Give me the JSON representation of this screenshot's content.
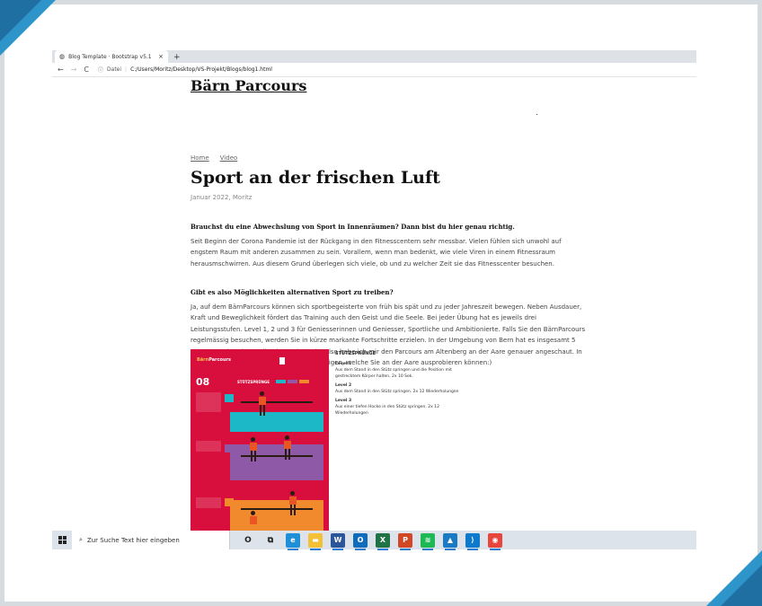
{
  "browser": {
    "tab_title": "Blog Template · Bootstrap v5.1",
    "tab_close": "×",
    "new_tab": "+",
    "back": "←",
    "forward": "→",
    "reload": "C",
    "info_icon": "ⓘ",
    "url_label": "Datei",
    "url_sep": "|",
    "url_path": "C:/Users/Moritz/Desktop/VS-Projekt/Blogs/blog1.html"
  },
  "site": {
    "brand": "Bärn Parcours",
    "nav": [
      "Home",
      "Video"
    ]
  },
  "post": {
    "title": "Sport an der frischen Luft",
    "meta": "Januar 2022, Moritz",
    "section1_heading": "Brauchst du eine Abwechslung von Sport in Innenräumen? Dann bist du hier genau richtig.",
    "section1_text": "Seit Beginn der Corona Pandemie ist der Rückgang in den Fitnesscentern sehr messbar. Vielen fühlen sich unwohl auf engstem Raum mit anderen zusammen zu sein. Vorallem, wenn man bedenkt, wie viele Viren in einem Fitnessraum herausmschwirren. Aus diesem Grund überlegen sich viele, ob und zu welcher Zeit sie das Fitnesscenter besuchen.",
    "section2_heading": "Gibt es also Möglichkeiten alternativen Sport zu treiben?",
    "section2_text": "Ja, auf dem BärnParcours können sich sportbegeisterte von früh bis spät und zu jeder Jahreszeit bewegen. Neben Ausdauer, Kraft und Beweglichkeit fördert das Training auch den Geist und die Seele. Bei jeder Übung hat es jeweils drei Leistungsstufen. Level 1, 2 und 3 für Geniesserinnen und Geniesser, Sportliche und Ambitionierte. Falls Sie den BärnParcours regelmässig besuchen, werden Sie in kürze markante Fortschritte erzielen. In der Umgebung von Bern hat es insgesamt 5 Parcours. Ich wohne selbst im Breitenrain, also habe ich mir den Parcours am Altenberg an der Aare genauer angeschaut. In der folge werde ich ein paar Übungen aufzeigen, welche Sie an der Aare ausprobieren können:)"
  },
  "poster": {
    "logo_a": "Bärn",
    "logo_b": "Parcours",
    "number": "08",
    "title": "STÜTZSPRÜNGE"
  },
  "exercise": {
    "title": "STÜTZSPRÜNGE",
    "level1": "Level 1",
    "level1_text": "Aus dem Stand in den Stütz springen und die Position mit gestrecktem Körper halten. 2x 10 Sek.",
    "level2": "Level 2",
    "level2_text": "Aus dem Stand in den Stütz springen. 2x 12 Wiederholungen",
    "level3": "Level 3",
    "level3_text": "Aus einer tiefen Hocke in den Stütz springen. 2x 12 Wiederholungen"
  },
  "taskbar": {
    "search_placeholder": "Zur Suche Text hier eingeben",
    "search_icon": "⌕",
    "apps": [
      {
        "name": "cortana-icon",
        "glyph": "O",
        "color": "transparent"
      },
      {
        "name": "task-view-icon",
        "glyph": "⧉",
        "color": "transparent"
      },
      {
        "name": "edge-icon",
        "glyph": "e",
        "color": "#1f8fd8"
      },
      {
        "name": "file-explorer-icon",
        "glyph": "▬",
        "color": "#f3c038"
      },
      {
        "name": "word-icon",
        "glyph": "W",
        "color": "#2b579a"
      },
      {
        "name": "outlook-icon",
        "glyph": "O",
        "color": "#0f6cbd"
      },
      {
        "name": "excel-icon",
        "glyph": "X",
        "color": "#217346"
      },
      {
        "name": "powerpoint-icon",
        "glyph": "P",
        "color": "#d24726"
      },
      {
        "name": "spotify-icon",
        "glyph": "≋",
        "color": "#1db954"
      },
      {
        "name": "photos-icon",
        "glyph": "▲",
        "color": "#1a7bc4"
      },
      {
        "name": "vscode-icon",
        "glyph": "⟩",
        "color": "#0e7acc"
      },
      {
        "name": "chrome-icon",
        "glyph": "◉",
        "color": "#e8453c"
      }
    ]
  }
}
